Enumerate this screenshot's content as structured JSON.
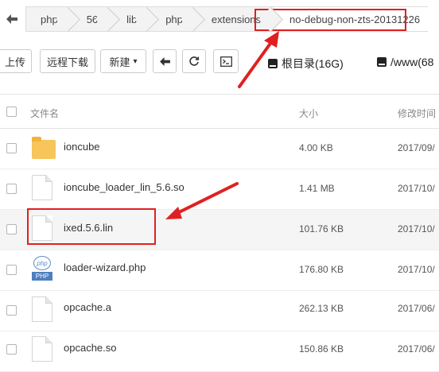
{
  "breadcrumb": {
    "back_icon": "arrow-left-icon",
    "items": [
      "php",
      "56",
      "lib",
      "php",
      "extensions",
      "no-debug-non-zts-20131226"
    ]
  },
  "toolbar": {
    "upload": "上传",
    "remote_download": "远程下载",
    "new": "新建",
    "new_caret": "▾",
    "back_icon": "arrow-left-icon",
    "refresh_icon": "refresh-icon",
    "terminal_icon": "terminal-icon"
  },
  "disks": [
    {
      "icon": "drive-icon",
      "label": "根目录(16G)"
    },
    {
      "icon": "drive-icon",
      "label": "/www(68"
    }
  ],
  "table": {
    "headers": {
      "name": "文件名",
      "size": "大小",
      "modified": "修改时间"
    },
    "rows": [
      {
        "icon": "folder-icon",
        "name": "ioncube",
        "size": "4.00 KB",
        "time": "2017/09/"
      },
      {
        "icon": "file-icon",
        "name": "ioncube_loader_lin_5.6.so",
        "size": "1.41 MB",
        "time": "2017/10/"
      },
      {
        "icon": "file-icon",
        "name": "ixed.5.6.lin",
        "size": "101.76 KB",
        "time": "2017/10/"
      },
      {
        "icon": "php-file-icon",
        "name": "loader-wizard.php",
        "size": "176.80 KB",
        "time": "2017/10/"
      },
      {
        "icon": "file-icon",
        "name": "opcache.a",
        "size": "262.13 KB",
        "time": "2017/06/"
      },
      {
        "icon": "file-icon",
        "name": "opcache.so",
        "size": "150.86 KB",
        "time": "2017/06/"
      }
    ]
  },
  "php_icon": {
    "top": "php",
    "bottom": "PHP"
  },
  "annotation_color": "#e02020"
}
